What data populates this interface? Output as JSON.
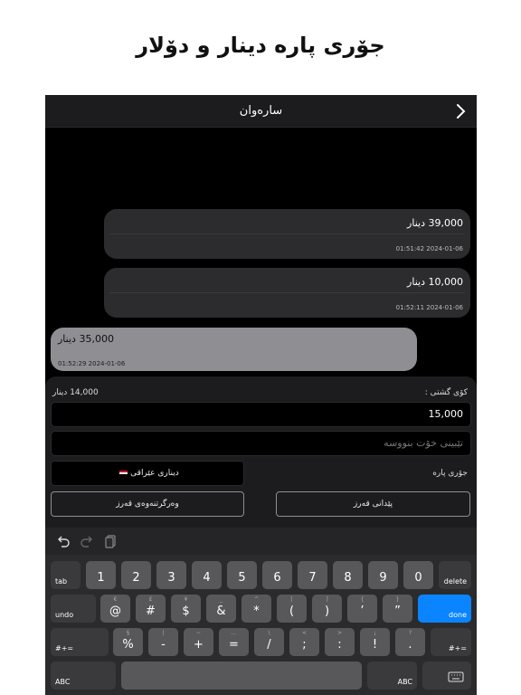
{
  "headline": "جۆری پارە دینار و دۆلار",
  "nav": {
    "title": "سارەوان"
  },
  "messages": [
    {
      "amount": "39,000 دینار",
      "time": "01:51:42 2024-01-06"
    },
    {
      "amount": "10,000 دینار",
      "time": "01:52:11 2024-01-06"
    },
    {
      "amount": "35,000 دینار",
      "time": "01:52:29 2024-01-06"
    }
  ],
  "form": {
    "total_label": "کۆی گشتی :",
    "total_value": "14,000 دینار",
    "amount_value": "15,000",
    "note_placeholder": "تێبینی خۆت بنووسە",
    "currency_label": "جۆری پارە",
    "currency_value": "دیناری عێراقی",
    "give_loan": "پێدانی قەرز",
    "receive_loan": "وەرگرتنەوەی قەرز"
  },
  "keyboard": {
    "row1": [
      "1",
      "2",
      "3",
      "4",
      "5",
      "6",
      "7",
      "8",
      "9",
      "0"
    ],
    "row2": [
      {
        "main": "@",
        "sub": "€"
      },
      {
        "main": "#",
        "sub": "£"
      },
      {
        "main": "$",
        "sub": "¥"
      },
      {
        "main": "&",
        "sub": "_"
      },
      {
        "main": "*",
        "sub": "^"
      },
      {
        "main": "(",
        "sub": "["
      },
      {
        "main": ")",
        "sub": "]"
      },
      {
        "main": "’",
        "sub": "{"
      },
      {
        "main": "”",
        "sub": "}"
      }
    ],
    "row3": [
      {
        "main": "%",
        "sub": "§"
      },
      {
        "main": "-",
        "sub": "|"
      },
      {
        "main": "+",
        "sub": "~"
      },
      {
        "main": "=",
        "sub": "…"
      },
      {
        "main": "/",
        "sub": "\\"
      },
      {
        "main": ";",
        "sub": "<"
      },
      {
        "main": ":",
        "sub": ">"
      },
      {
        "main": "!",
        "sub": "¡"
      },
      {
        "main": ".",
        "sub": "?"
      }
    ],
    "tab": "tab",
    "delete": "delete",
    "undo": "undo",
    "done": "done",
    "shift_left": "#+=",
    "shift_right": "#+=",
    "abc_left": "ABC",
    "abc_right": "ABC",
    "colors": {
      "done": "#0a84ff",
      "key": "#58585b",
      "dark_key": "#3a3a3d"
    }
  }
}
